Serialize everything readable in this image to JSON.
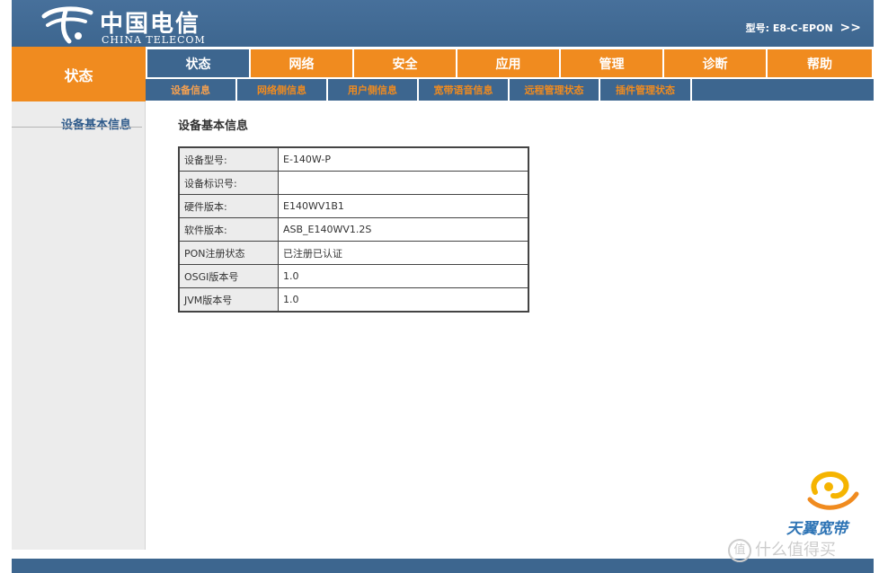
{
  "header": {
    "logo_cn": "中国电信",
    "logo_en": "CHINA TELECOM",
    "model_prefix": "型号:",
    "model_value": "E8-C-EPON",
    "model_arrow": ">>"
  },
  "side_tab": "状态",
  "main_nav": [
    "状态",
    "网络",
    "安全",
    "应用",
    "管理",
    "诊断",
    "帮助"
  ],
  "sub_nav": [
    "设备信息",
    "网络侧信息",
    "用户侧信息",
    "宽带语音信息",
    "远程管理状态",
    "插件管理状态"
  ],
  "sidebar": {
    "item": "设备基本信息"
  },
  "content": {
    "title": "设备基本信息",
    "rows": [
      {
        "label": "设备型号:",
        "value": "E-140W-P"
      },
      {
        "label": "设备标识号:",
        "value": ""
      },
      {
        "label": "硬件版本:",
        "value": "E140WV1B1"
      },
      {
        "label": "软件版本:",
        "value": "ASB_E140WV1.2S"
      },
      {
        "label": "PON注册状态",
        "value": "已注册已认证"
      },
      {
        "label": "OSGI版本号",
        "value": "1.0"
      },
      {
        "label": "JVM版本号",
        "value": "1.0"
      }
    ]
  },
  "brand": "天翼宽带",
  "watermark": {
    "icon": "值",
    "text": "什么值得买"
  },
  "colors": {
    "header_blue": "#3d668f",
    "orange": "#f08b1f",
    "sidebar_gray": "#ececec"
  }
}
